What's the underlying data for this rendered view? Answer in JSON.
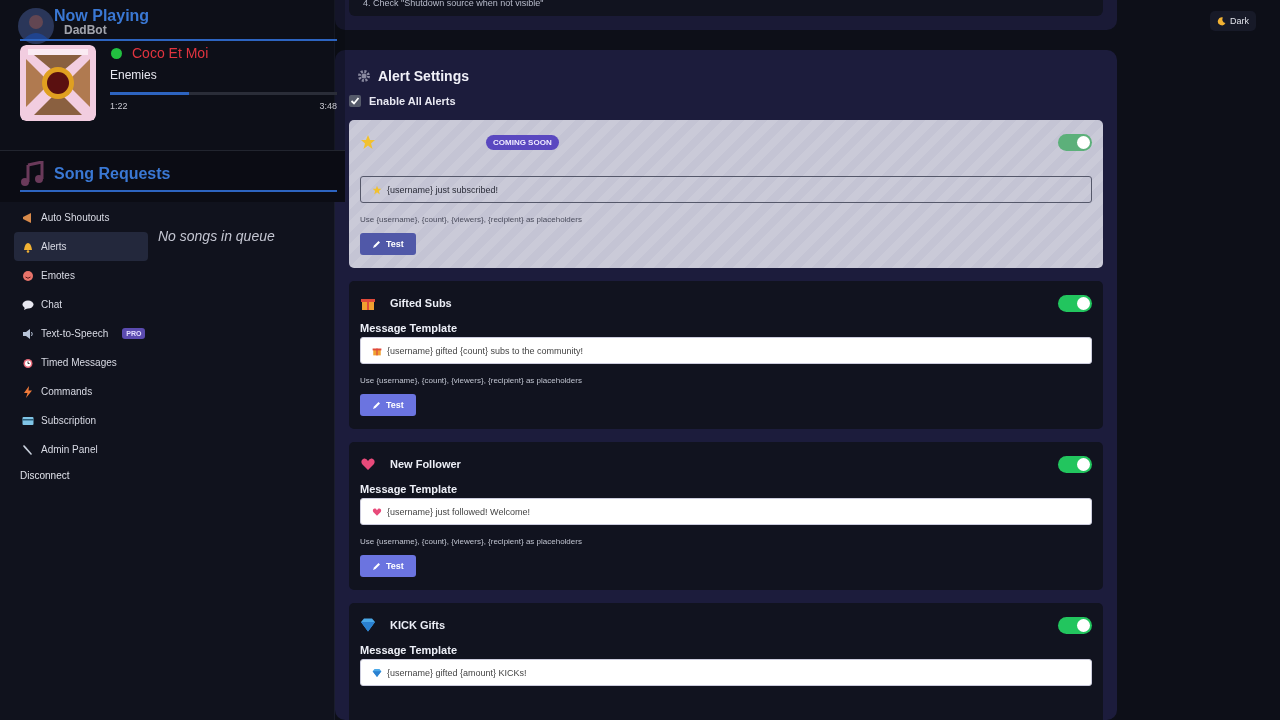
{
  "sidebar": {
    "brand": "DadBot",
    "items": [
      {
        "label": "Auto Shoutouts",
        "selected": false
      },
      {
        "label": "Alerts",
        "selected": true
      },
      {
        "label": "Emotes",
        "selected": false
      },
      {
        "label": "Chat",
        "selected": false
      },
      {
        "label": "Text-to-Speech",
        "badge": "PRO",
        "selected": false
      },
      {
        "label": "Timed Messages",
        "selected": false
      },
      {
        "label": "Commands",
        "selected": false
      },
      {
        "label": "Subscription",
        "selected": false
      },
      {
        "label": "Admin Panel",
        "selected": false
      }
    ],
    "disconnect": "Disconnect"
  },
  "theme_button": "Dark",
  "setup_note": "4. Check \"Shutdown source when not visible\"",
  "alert_settings": {
    "title": "Alert Settings",
    "enable_all": {
      "label": "Enable All Alerts",
      "checked": true
    },
    "cards": [
      {
        "badge": "COMING SOON",
        "disabled": true,
        "on": true,
        "template": "{username} just subscribed!",
        "hint": "Use {username}, {count}, {viewers}, {recipient} as placeholders",
        "button": "Test"
      },
      {
        "title": "Gifted Subs",
        "disabled": false,
        "on": true,
        "label": "Message Template",
        "template": "{username} gifted {count} subs to the community!",
        "hint": "Use {username}, {count}, {viewers}, {recipient} as placeholders",
        "button": "Test"
      },
      {
        "title": "New Follower",
        "disabled": false,
        "on": true,
        "label": "Message Template",
        "template": "{username} just followed! Welcome!",
        "hint": "Use {username}, {count}, {viewers}, {recipient} as placeholders",
        "button": "Test"
      },
      {
        "title": "KICK Gifts",
        "disabled": false,
        "on": true,
        "label": "Message Template",
        "template": "{username} gifted {amount} KICKs!"
      }
    ]
  },
  "now_playing": {
    "title": "Now Playing",
    "track": "Coco Et Moi",
    "artist": "Enemies",
    "playing": true,
    "level": 0.35,
    "elapsed": "1:22",
    "duration": "3:48"
  },
  "song_requests": {
    "title": "Song Requests",
    "empty_text": "No songs in queue"
  }
}
